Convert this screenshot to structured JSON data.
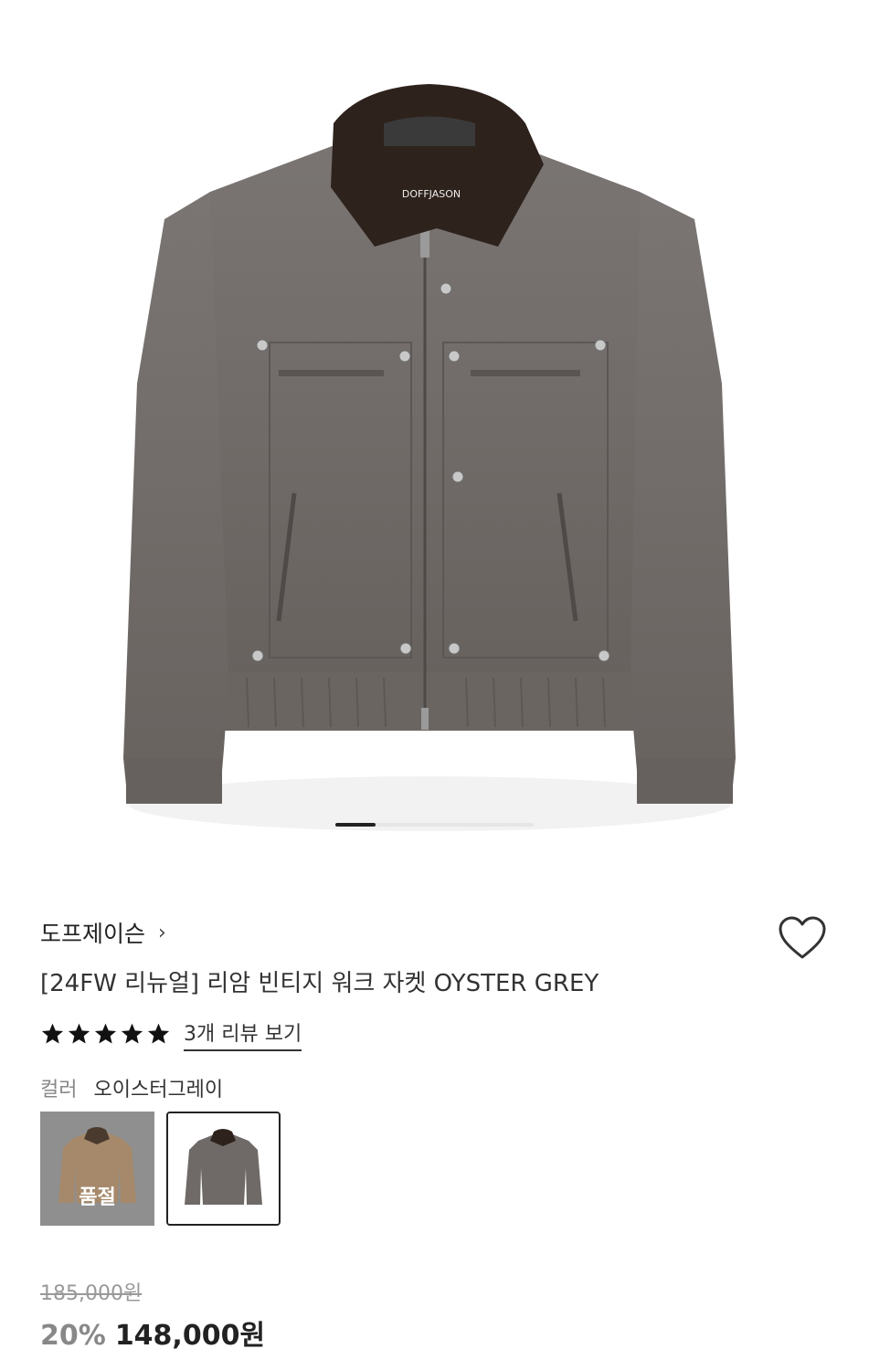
{
  "product": {
    "brand_link": "도프제이슨",
    "title": "[24FW 리뉴얼] 리암 빈티지 워크 자켓 OYSTER GREY",
    "image_label": "DOFFJASON",
    "rating_stars": 5,
    "review_link": "3개 리뷰 보기",
    "color_label": "컬러",
    "color_value": "오이스터그레이",
    "swatches": [
      {
        "badge": "품절",
        "color": "#a5896a"
      },
      {
        "badge": "",
        "color": "#6f6a67"
      }
    ],
    "original_price": "185,000원",
    "discount": "20%",
    "sale_price": "148,000원"
  },
  "carousel": {
    "current": 1,
    "total": 5
  },
  "colors": {
    "jacket": "#6f6a67",
    "collar": "#2e221c",
    "text": "#222222",
    "muted": "#888888"
  }
}
